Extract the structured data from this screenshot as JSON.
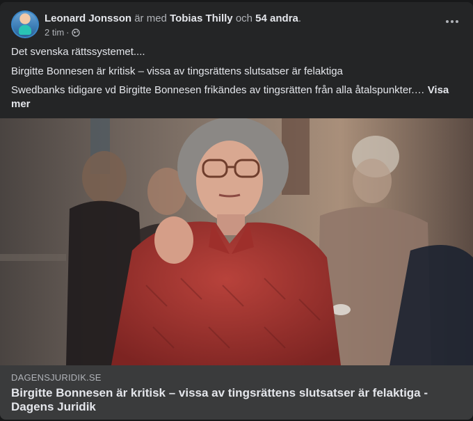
{
  "post": {
    "author": "Leonard Jonsson",
    "with_text": "är med",
    "tagged": "Tobias Thilly",
    "and_text": "och",
    "others": "54 andra",
    "period": ".",
    "time": "2 tim",
    "separator": "·",
    "privacy_icon": "globe-icon",
    "more_icon": "more-dots-icon",
    "line1": "Det svenska rättssystemet....",
    "line2": "Birgitte Bonnesen är kritisk – vissa av tingsrättens slutsatser är felaktiga",
    "line3": "Swedbanks tidigare vd Birgitte Bonnesen frikändes av tingsrätten från alla åtalspunkter.…",
    "see_more": "Visa mer"
  },
  "link": {
    "domain": "DAGENSJURIDIK.SE",
    "title": "Birgitte Bonnesen är kritisk – vissa av tingsrättens slutsatser är felaktiga - Dagens Juridik"
  },
  "colors": {
    "card_bg": "#242526",
    "link_bg": "#3a3b3c",
    "text_primary": "#e4e6eb",
    "text_secondary": "#b0b3b8"
  }
}
